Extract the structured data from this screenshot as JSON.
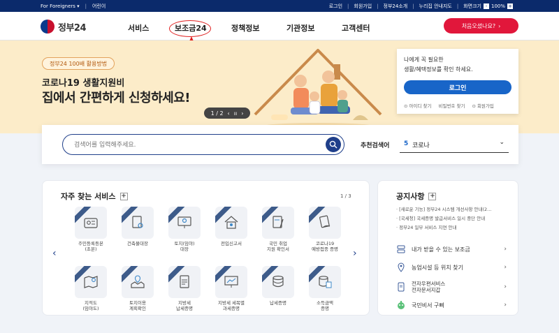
{
  "topbar": {
    "foreigners": "For Foreigners ▾",
    "easy": "어린이",
    "login": "로그인",
    "signup": "회원가입",
    "intro": "정부24소개",
    "sitemap": "누리집 안내지도",
    "zoom_label": "화면크기",
    "zoom_minus": "-",
    "zoom_value": "100%",
    "zoom_plus": "+"
  },
  "header": {
    "logo": "정부24",
    "nav": [
      "서비스",
      "보조금24",
      "정책정보",
      "기관정보",
      "고객센터"
    ],
    "cta": "처음오셨나요?",
    "cta_arrow": "›"
  },
  "banner": {
    "pill": "정부24 100배 활용방법",
    "line1": "코로나19 생활지원비",
    "line2": "집에서 간편하게 신청하세요!",
    "pager": "1 / 2",
    "pager_prev": "‹",
    "pager_pause": "ıı",
    "pager_next": "›"
  },
  "login_card": {
    "line1": "나에게 꼭 필요한",
    "line2": "생활/혜택정보를 확인 하세요.",
    "button": "로그인",
    "links": [
      "⊙ 아이디 찾기",
      "비밀번호 찾기",
      "⊙ 회원가입"
    ]
  },
  "search": {
    "placeholder": "검색어를 입력해주세요.",
    "rec_label": "추천검색어",
    "rec_num": "5",
    "rec_term": "코로나",
    "rec_chev": "⌄"
  },
  "services": {
    "title": "자주 찾는 서비스",
    "plus": "+",
    "page": "1 / 3",
    "prev": "‹",
    "next": "›",
    "tiles": [
      {
        "label": "주민등록등본\n(초본)",
        "icon": "id-card-icon"
      },
      {
        "label": "건축물대장",
        "icon": "document-search-icon"
      },
      {
        "label": "토지(임야)\n대장",
        "icon": "map-pin-icon"
      },
      {
        "label": "전입신고서",
        "icon": "house-gear-icon"
      },
      {
        "label": "국민 취업\n지원 확인서",
        "icon": "document-pen-icon"
      },
      {
        "label": "코로나19\n예방접종 증명",
        "icon": "document-hand-icon"
      },
      {
        "label": "지적도\n(임야도)",
        "icon": "map-icon"
      },
      {
        "label": "토지이용\n계획확인",
        "icon": "map-location-icon"
      },
      {
        "label": "지방세\n납세증명",
        "icon": "document-icon"
      },
      {
        "label": "지방세 세목별\n과세증명",
        "icon": "chart-board-icon"
      },
      {
        "label": "납세증명",
        "icon": "coin-stack-icon"
      },
      {
        "label": "소득금액\n증명",
        "icon": "database-doc-icon"
      }
    ]
  },
  "notice": {
    "title": "공지사항",
    "plus": "+",
    "items": [
      "· [새로운 기능] 정부24 시스템 개선사항 안내(2...",
      "· [국세청] 국세증명 발급서비스 일시 중단 안내",
      "· 정부24 일부 서비스 지연 안내"
    ],
    "links": [
      {
        "label": "내가 받을 수 있는 보조금",
        "icon": "server-icon"
      },
      {
        "label": "농업시설 등 위치 찾기",
        "icon": "location-pin-icon"
      },
      {
        "label": "전자우편서비스\n전자문서지갑",
        "icon": "phone-doc-icon"
      },
      {
        "label": "국민비서 구삐",
        "icon": "mascot-icon"
      }
    ],
    "chev": "›"
  },
  "colors": {
    "navy": "#0b2a6b",
    "primary": "#1865c8",
    "cta": "#e1173b",
    "banner": "#fcecc9"
  }
}
